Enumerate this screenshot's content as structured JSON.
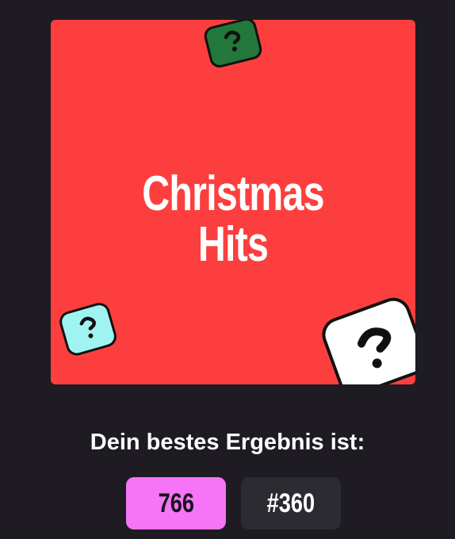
{
  "cover": {
    "title_line1": "Christmas",
    "title_line2": "Hits",
    "background_color": "#fc3f3e",
    "icons": [
      {
        "name": "question-card-icon",
        "color": "#22773a"
      },
      {
        "name": "question-card-icon",
        "color": "#9ff4f2"
      },
      {
        "name": "question-card-icon",
        "color": "#ffffff"
      }
    ]
  },
  "result": {
    "label": "Dein bestes Ergebnis ist:",
    "score": "766",
    "rank": "#360",
    "score_color": "#f574f7",
    "rank_color": "#2c2b31"
  }
}
